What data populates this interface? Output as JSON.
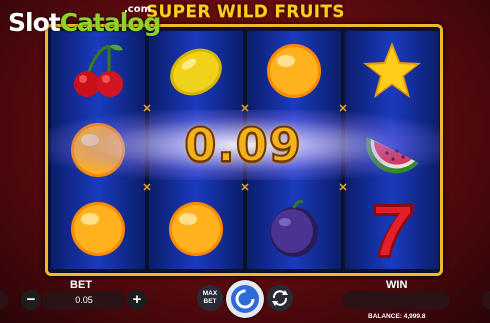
{
  "watermark": {
    "part1": "Slot",
    "part2": "Catalog",
    "suffix": ".com"
  },
  "game": {
    "title": "SUPER WILD FRUITS"
  },
  "reels": [
    [
      "cherry",
      "orange",
      "orange"
    ],
    [
      "lemon",
      "orange",
      "orange"
    ],
    [
      "orange",
      "orange",
      "plum"
    ],
    [
      "star",
      "watermelon",
      "seven"
    ]
  ],
  "win_display": {
    "amount": "0.09"
  },
  "controls": {
    "bet_label": "BET",
    "bet_value": "0.05",
    "minus": "−",
    "plus": "+",
    "max_bet_line1": "MAX",
    "max_bet_line2": "BET",
    "win_label": "WIN",
    "balance": "BALANCE: 4,999.8"
  },
  "colors": {
    "frame": "#f2b82a",
    "reel": "#1a3bbf",
    "title": "#ffcd1a",
    "spin": "#2f6ad9"
  }
}
